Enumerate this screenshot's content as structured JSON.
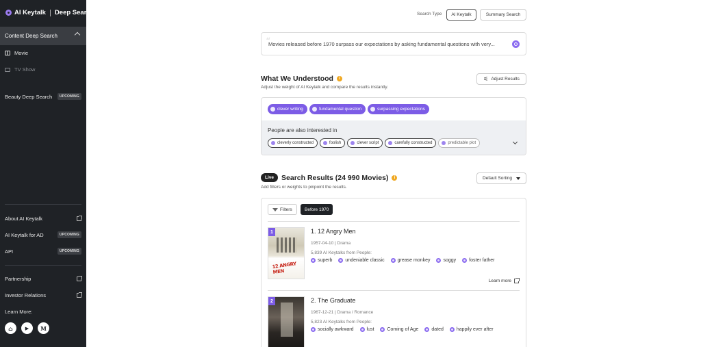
{
  "brand": {
    "name": "AI Keytalk",
    "product": "Deep Search"
  },
  "sidebar": {
    "active": {
      "label": "Content Deep Search"
    },
    "sub_items": [
      {
        "label": "Movie"
      },
      {
        "label": "TV Show"
      }
    ],
    "beauty": {
      "label": "Beauty Deep Search",
      "badge": "UPCOMING"
    },
    "links": [
      {
        "label": "About AI Keytalk"
      },
      {
        "label": "AI Keytalk for AD",
        "badge": "UPCOMING"
      },
      {
        "label": "API",
        "badge": "UPCOMING"
      },
      {
        "label": "Partnership"
      },
      {
        "label": "Investor Relations"
      }
    ],
    "learn_more": "Learn More:",
    "socials": [
      {
        "icon": "home-icon",
        "glyph": "⌂"
      },
      {
        "icon": "youtube-icon",
        "glyph": "▶"
      },
      {
        "icon": "medium-icon",
        "glyph": "M"
      }
    ]
  },
  "header": {
    "search_type_label": "Search Type",
    "options": [
      "AI Keytalk",
      "Summary Search"
    ],
    "selected": "AI Keytalk"
  },
  "query": {
    "text": "Movies released before 1970 surpass our expectations by asking fundamental questions with very..."
  },
  "understood": {
    "title": "What We Understood",
    "subtitle": "Adjust the weight of AI Keytalk and compare the results instantly.",
    "adjust_label": "Adjust Results",
    "keytalks": [
      "clever writing",
      "fundamental question",
      "surpassing expectations"
    ],
    "interest_title": "People are also interested in",
    "interests": [
      "cleverly constructed",
      "foolish",
      "clever script",
      "carefully constructed",
      "predictable plot"
    ]
  },
  "results": {
    "live_label": "Live",
    "title": "Search Results (24 990 Movies)",
    "subtitle": "Add filters or weights to pinpoint the results.",
    "sort_label": "Default Sorting",
    "filters_label": "Filters",
    "active_filter": "Before 1970",
    "learn_more": "Learn more",
    "movies": [
      {
        "rank": "1",
        "title": "1. 12 Angry Men",
        "meta": "1957-04-10 | Drama",
        "keytalks": "5,839 AI Keytalks from People:",
        "poster_text": "12 ANGRY MEN",
        "tags": [
          "superb",
          "undeniable classic",
          "grease monkey",
          "soggy",
          "foster father"
        ]
      },
      {
        "rank": "2",
        "title": "2. The Graduate",
        "meta": "1967-12-21 | Drama / Romance",
        "keytalks": "5,823 AI Keytalks from People:",
        "tags": [
          "socially awkward",
          "lust",
          "Coming of Age",
          "dated",
          "happily ever after"
        ]
      }
    ]
  },
  "colors": {
    "accent": "#7c5ce6",
    "sidebar_bg": "#1f2226",
    "info": "#f0a821"
  }
}
